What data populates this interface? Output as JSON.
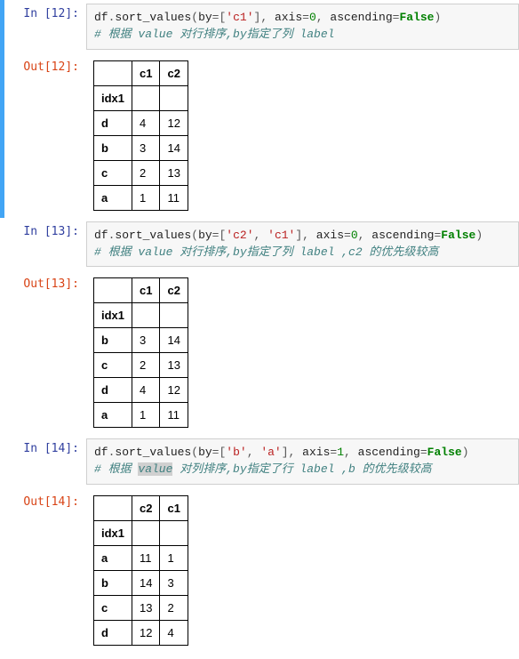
{
  "cells": [
    {
      "prompt_in_label": "In  [12]:",
      "prompt_out_label": "Out[12]:",
      "code_tokens": [
        "df",
        ".",
        "sort_values",
        "(",
        "by",
        "=",
        "[",
        "'c1'",
        "]",
        ",",
        "axis",
        "=",
        "0",
        ",",
        "ascending",
        "=",
        "False",
        ")"
      ],
      "comment": "# 根据 value 对行排序,by指定了列 label",
      "comment_sel": null,
      "table": {
        "index_name": "idx1",
        "columns": [
          "c1",
          "c2"
        ],
        "rows": [
          {
            "idx": "d",
            "vals": [
              "4",
              "12"
            ]
          },
          {
            "idx": "b",
            "vals": [
              "3",
              "14"
            ]
          },
          {
            "idx": "c",
            "vals": [
              "2",
              "13"
            ]
          },
          {
            "idx": "a",
            "vals": [
              "1",
              "11"
            ]
          }
        ]
      },
      "running": true
    },
    {
      "prompt_in_label": "In  [13]:",
      "prompt_out_label": "Out[13]:",
      "code_tokens": [
        "df",
        ".",
        "sort_values",
        "(",
        "by",
        "=",
        "[",
        "'c2'",
        ",",
        "'c1'",
        "]",
        ",",
        "axis",
        "=",
        "0",
        ",",
        "ascending",
        "=",
        "False",
        ")"
      ],
      "comment": "# 根据 value 对行排序,by指定了列 label ,c2 的优先级较高",
      "comment_sel": null,
      "table": {
        "index_name": "idx1",
        "columns": [
          "c1",
          "c2"
        ],
        "rows": [
          {
            "idx": "b",
            "vals": [
              "3",
              "14"
            ]
          },
          {
            "idx": "c",
            "vals": [
              "2",
              "13"
            ]
          },
          {
            "idx": "d",
            "vals": [
              "4",
              "12"
            ]
          },
          {
            "idx": "a",
            "vals": [
              "1",
              "11"
            ]
          }
        ]
      },
      "running": false
    },
    {
      "prompt_in_label": "In  [14]:",
      "prompt_out_label": "Out[14]:",
      "code_tokens": [
        "df",
        ".",
        "sort_values",
        "(",
        "by",
        "=",
        "[",
        "'b'",
        ",",
        "'a'",
        "]",
        ",",
        "axis",
        "=",
        "1",
        ",",
        "ascending",
        "=",
        "False",
        ")"
      ],
      "comment": "# 根据 value 对列排序,by指定了行 label ,b 的优先级较高",
      "comment_sel": [
        5,
        10
      ],
      "table": {
        "index_name": "idx1",
        "columns": [
          "c2",
          "c1"
        ],
        "rows": [
          {
            "idx": "a",
            "vals": [
              "11",
              "1"
            ]
          },
          {
            "idx": "b",
            "vals": [
              "14",
              "3"
            ]
          },
          {
            "idx": "c",
            "vals": [
              "13",
              "2"
            ]
          },
          {
            "idx": "d",
            "vals": [
              "12",
              "4"
            ]
          }
        ]
      },
      "running": false
    }
  ],
  "chart_data": [
    {
      "type": "table",
      "title": "Out[12]",
      "index_name": "idx1",
      "columns": [
        "c1",
        "c2"
      ],
      "index": [
        "d",
        "b",
        "c",
        "a"
      ],
      "data": [
        [
          4,
          12
        ],
        [
          3,
          14
        ],
        [
          2,
          13
        ],
        [
          1,
          11
        ]
      ]
    },
    {
      "type": "table",
      "title": "Out[13]",
      "index_name": "idx1",
      "columns": [
        "c1",
        "c2"
      ],
      "index": [
        "b",
        "c",
        "d",
        "a"
      ],
      "data": [
        [
          3,
          14
        ],
        [
          2,
          13
        ],
        [
          4,
          12
        ],
        [
          1,
          11
        ]
      ]
    },
    {
      "type": "table",
      "title": "Out[14]",
      "index_name": "idx1",
      "columns": [
        "c2",
        "c1"
      ],
      "index": [
        "a",
        "b",
        "c",
        "d"
      ],
      "data": [
        [
          11,
          1
        ],
        [
          14,
          3
        ],
        [
          13,
          2
        ],
        [
          12,
          4
        ]
      ]
    }
  ]
}
